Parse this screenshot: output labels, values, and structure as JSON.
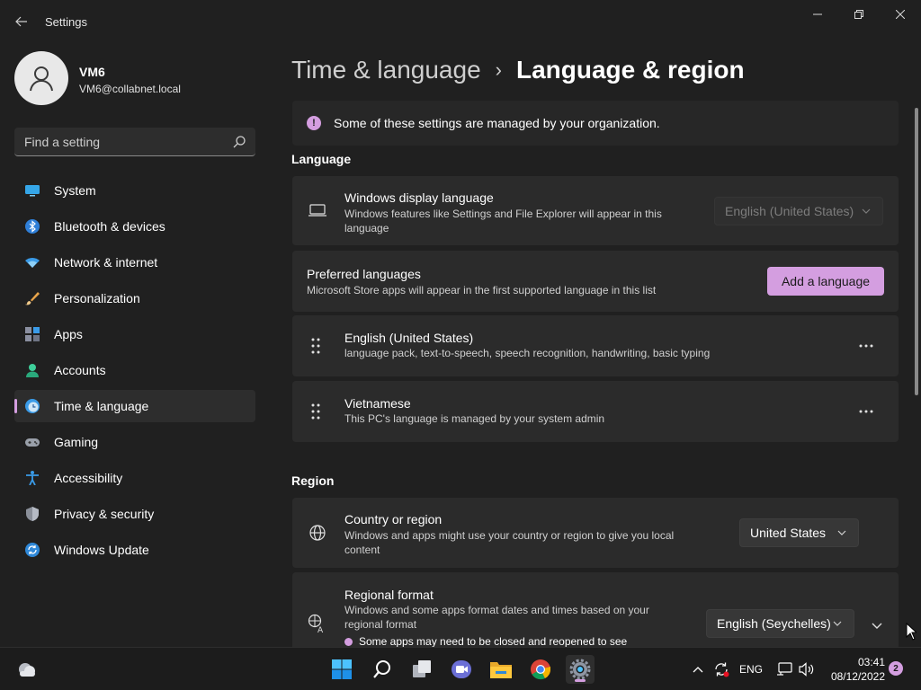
{
  "window": {
    "title": "Settings"
  },
  "profile": {
    "name": "VM6",
    "email": "VM6@collabnet.local"
  },
  "search": {
    "placeholder": "Find a setting"
  },
  "sidebar": {
    "items": [
      {
        "label": "System",
        "icon": "monitor-icon"
      },
      {
        "label": "Bluetooth & devices",
        "icon": "bluetooth-icon"
      },
      {
        "label": "Network & internet",
        "icon": "wifi-icon"
      },
      {
        "label": "Personalization",
        "icon": "brush-icon"
      },
      {
        "label": "Apps",
        "icon": "apps-icon"
      },
      {
        "label": "Accounts",
        "icon": "person-icon"
      },
      {
        "label": "Time & language",
        "icon": "clock-globe-icon",
        "active": true
      },
      {
        "label": "Gaming",
        "icon": "gamepad-icon"
      },
      {
        "label": "Accessibility",
        "icon": "accessibility-icon"
      },
      {
        "label": "Privacy & security",
        "icon": "shield-icon"
      },
      {
        "label": "Windows Update",
        "icon": "update-icon"
      }
    ]
  },
  "breadcrumb": {
    "parent": "Time & language",
    "separator": "›",
    "current": "Language & region"
  },
  "info_bar": {
    "text": "Some of these settings are managed by your organization.",
    "icon_glyph": "!"
  },
  "language_section": {
    "title": "Language",
    "display_language": {
      "title": "Windows display language",
      "description": "Windows features like Settings and File Explorer will appear in this language",
      "value": "English (United States)"
    },
    "preferred_languages": {
      "title": "Preferred languages",
      "description": "Microsoft Store apps will appear in the first supported language in this list",
      "add_button": "Add a language"
    },
    "languages": [
      {
        "name": "English (United States)",
        "description": "language pack, text-to-speech, speech recognition, handwriting, basic typing"
      },
      {
        "name": "Vietnamese",
        "description": "This PC's language is managed by your system admin"
      }
    ]
  },
  "region_section": {
    "title": "Region",
    "country": {
      "title": "Country or region",
      "description": "Windows and apps might use your country or region to give you local content",
      "value": "United States"
    },
    "regional_format": {
      "title": "Regional format",
      "description": "Windows and some apps format dates and times based on your regional format",
      "value": "English (Seychelles)",
      "note": "Some apps may need to be closed and reopened to see"
    }
  },
  "taskbar": {
    "input_language": "ENG",
    "time": "03:41",
    "date": "08/12/2022",
    "notification_count": "2"
  },
  "colors": {
    "accent": "#d49ee0",
    "background": "#202020",
    "card": "#2b2b2b"
  }
}
